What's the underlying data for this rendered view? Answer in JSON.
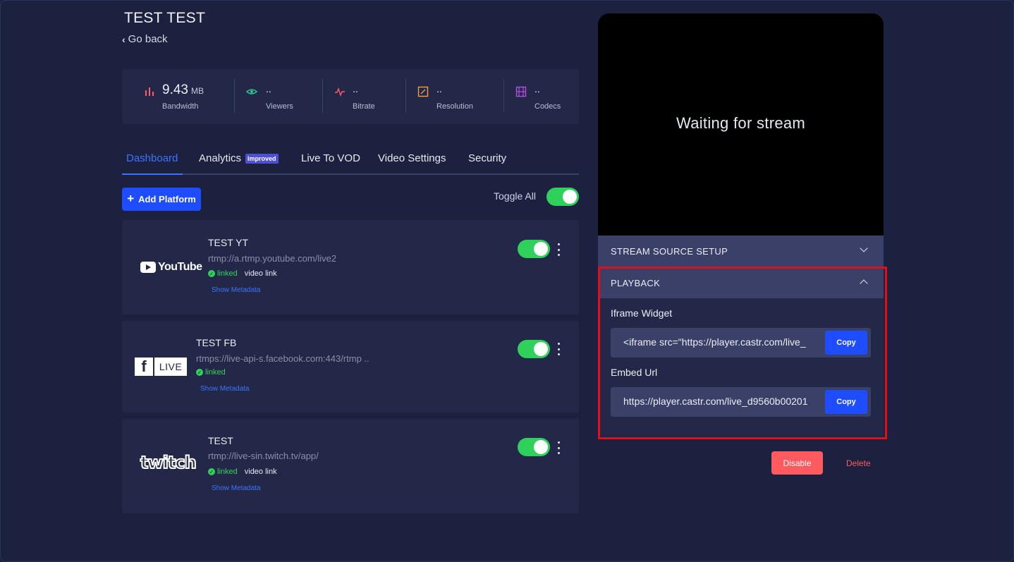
{
  "header": {
    "title": "TEST TEST",
    "go_back": "Go back"
  },
  "stats": [
    {
      "icon": "bar-chart-icon",
      "value": "9.43",
      "unit": "MB",
      "label": "Bandwidth"
    },
    {
      "icon": "eye-icon",
      "value": "..",
      "label": "Viewers"
    },
    {
      "icon": "pulse-icon",
      "value": "..",
      "label": "Bitrate"
    },
    {
      "icon": "resolution-icon",
      "value": "..",
      "label": "Resolution"
    },
    {
      "icon": "film-icon",
      "value": "..",
      "label": "Codecs"
    }
  ],
  "tabs": [
    {
      "label": "Dashboard",
      "active": true
    },
    {
      "label": "Analytics",
      "badge": "Improved"
    },
    {
      "label": "Live To VOD"
    },
    {
      "label": "Video Settings"
    },
    {
      "label": "Security"
    }
  ],
  "platforms_toolbar": {
    "add_label": "Add Platform",
    "toggle_all_label": "Toggle All",
    "toggle_all_on": true
  },
  "platforms": [
    {
      "logo": "YouTube",
      "name": "TEST YT",
      "url": "rtmp://a.rtmp.youtube.com/live2",
      "status": "linked",
      "extra": "video link",
      "meta": "Show Metadata",
      "enabled": true
    },
    {
      "logo": "LIVE",
      "name": "TEST FB",
      "url": "rtmps://live-api-s.facebook.com:443/rtmp ..",
      "status": "linked",
      "meta": "Show Metadata",
      "enabled": true
    },
    {
      "logo": "twitch",
      "name": "TEST",
      "url": "rtmp://live-sin.twitch.tv/app/",
      "status": "linked",
      "extra": "video link",
      "meta": "Show Metadata",
      "enabled": true
    }
  ],
  "player": {
    "status_text": "Waiting for stream"
  },
  "stream_source": {
    "title": "STREAM SOURCE SETUP"
  },
  "playback": {
    "title": "PLAYBACK",
    "iframe_label": "Iframe Widget",
    "iframe_value": "<iframe src=\"https://player.castr.com/live_",
    "embed_label": "Embed Url",
    "embed_value": "https://player.castr.com/live_d9560b00201",
    "copy_label": "Copy"
  },
  "actions": {
    "disable_label": "Disable",
    "delete_label": "Delete"
  },
  "colors": {
    "background": "#1c2140",
    "panel": "#232849",
    "accent": "#1e4cff",
    "toggle_on": "#2fd15a",
    "danger": "#ff5a5f",
    "highlight": "#e0101a"
  }
}
